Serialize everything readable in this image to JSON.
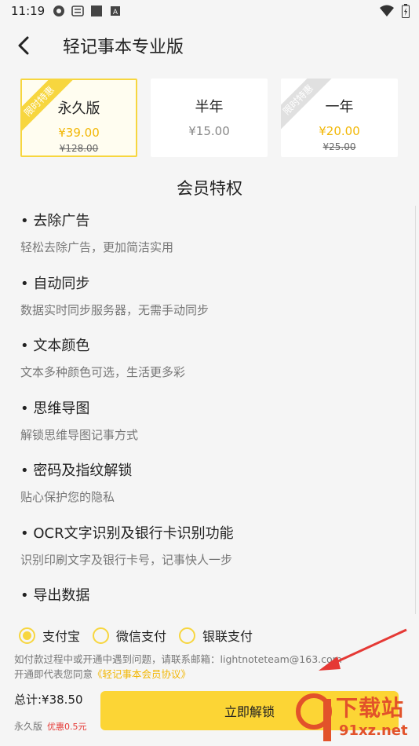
{
  "status_bar": {
    "time": "11:19"
  },
  "header": {
    "title": "轻记事本专业版"
  },
  "plans": [
    {
      "name": "永久版",
      "price": "¥39.00",
      "original": "¥128.00",
      "ribbon": "限时特惠",
      "selected": true
    },
    {
      "name": "半年",
      "price": "¥15.00",
      "original": "",
      "ribbon": "",
      "selected": false
    },
    {
      "name": "一年",
      "price": "¥20.00",
      "original": "¥25.00",
      "ribbon": "限时特惠",
      "selected": false
    }
  ],
  "section_title": "会员特权",
  "features": [
    {
      "title": "去除广告",
      "desc": "轻松去除广告，更加简洁实用"
    },
    {
      "title": "自动同步",
      "desc": "数据实时同步服务器，无需手动同步"
    },
    {
      "title": "文本颜色",
      "desc": "文本多种颜色可选，生活更多彩"
    },
    {
      "title": "思维导图",
      "desc": "解锁思维导图记事方式"
    },
    {
      "title": "密码及指纹解锁",
      "desc": "贴心保护您的隐私"
    },
    {
      "title": "OCR文字识别及银行卡识别功能",
      "desc": "识别印刷文字及银行卡号，记事快人一步"
    },
    {
      "title": "导出数据",
      "desc": ""
    }
  ],
  "payment": {
    "options": [
      "支付宝",
      "微信支付",
      "银联支付"
    ],
    "selected": "支付宝"
  },
  "notice": {
    "line1": "如付款过程中或开通中遇到问题，请联系邮箱：lightnoteteam@163.com",
    "line2_prefix": "开通即代表您同意",
    "line2_link": "《轻记事本会员协议》"
  },
  "footer": {
    "total": "总计:¥38.50",
    "plan": "永久版",
    "discount": "优惠0.5元",
    "buy_label": "立即解锁"
  },
  "watermark": {
    "text1": "下载站",
    "text2": "91xz.net"
  },
  "colors": {
    "accent": "#fcd535",
    "price": "#f2b705",
    "discount": "#e53935"
  }
}
